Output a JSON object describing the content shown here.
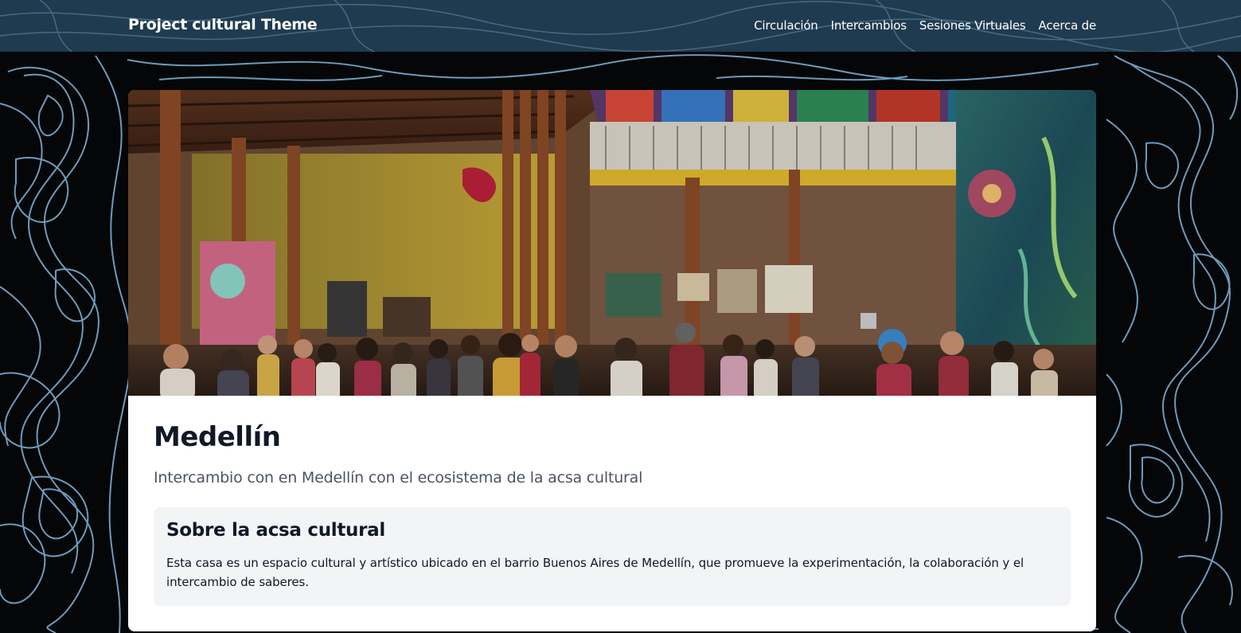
{
  "navbar": {
    "brand": "Project cultural Theme",
    "links": [
      {
        "label": "Circulación"
      },
      {
        "label": "Intercambios"
      },
      {
        "label": "Sesiones Virtuales"
      },
      {
        "label": "Acerca de"
      }
    ]
  },
  "page": {
    "title": "Medellín",
    "subtitle": "Intercambio con en Medellín con el ecosistema de la acsa cultural",
    "about": {
      "heading": "Sobre la acsa cultural",
      "text": "Esta casa es un espacio cultural y artístico ubicado en el barrio Buenos Aires de Medellín, que promueve la experimentación, la colaboración y el intercambio de saberes."
    }
  },
  "colors": {
    "navbar_bg": "#1f3b4f",
    "page_bg": "#050607",
    "topo_line": "#7fb6dc",
    "card_bg": "#ffffff",
    "about_bg": "#f3f4f6",
    "title_text": "#111827",
    "subtitle_text": "#4b5563"
  },
  "icons": {
    "background": "topographic-contour-pattern",
    "hero": "cultural-house-interior-photo"
  }
}
